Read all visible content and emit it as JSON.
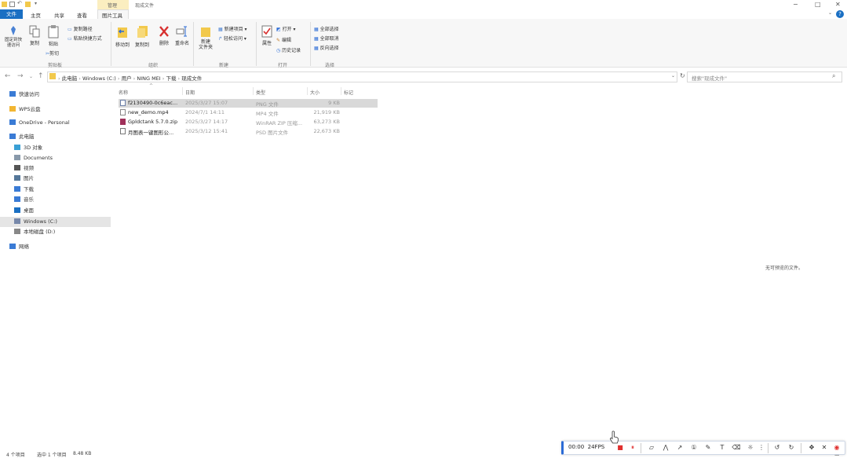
{
  "titlebar": {
    "context_group": "管理",
    "context_title": "现成文件",
    "window_controls": [
      "−",
      "□",
      "✕"
    ]
  },
  "ribbon_tabs": {
    "file": "文件",
    "home": "主页",
    "share": "共享",
    "view": "查看",
    "picture_tools": "图片工具"
  },
  "ribbon": {
    "clipboard": {
      "pin": "固定到快速访问",
      "copy": "复制",
      "paste": "粘贴",
      "copy_path": "复制路径",
      "paste_shortcut": "粘贴快捷方式",
      "cut": "剪切",
      "label": "剪贴板"
    },
    "organize": {
      "move_to": "移动到",
      "copy_to": "复制到",
      "delete": "删除",
      "rename": "重命名",
      "label": "组织"
    },
    "new": {
      "new_folder": "新建\n文件夹",
      "new_item": "新建项目",
      "easy_access": "轻松访问",
      "label": "新建"
    },
    "open": {
      "properties": "属性",
      "open": "打开",
      "edit": "编辑",
      "history": "历史记录",
      "label": "打开"
    },
    "select": {
      "select_all": "全部选择",
      "select_none": "全部取消",
      "invert": "反向选择",
      "label": "选择"
    }
  },
  "address": {
    "crumbs": [
      "此电脑",
      "Windows (C:)",
      "用户",
      "NING MEI",
      "下载",
      "现成文件"
    ],
    "search_placeholder": "搜索\"现成文件\""
  },
  "nav": [
    {
      "label": "快速访问",
      "color": "#3a7bd5"
    },
    {
      "label": "WPS云盘",
      "color": "#f2b632"
    },
    {
      "label": "OneDrive - Personal",
      "color": "#3a7bd5"
    },
    {
      "label": "此电脑",
      "color": "#3a7bd5"
    },
    {
      "label": "3D 对象",
      "color": "#3aa0d5"
    },
    {
      "label": "Documents",
      "color": "#8899aa"
    },
    {
      "label": "视频",
      "color": "#555555"
    },
    {
      "label": "图片",
      "color": "#557799"
    },
    {
      "label": "下载",
      "color": "#3a7bd5"
    },
    {
      "label": "音乐",
      "color": "#3a7bd5"
    },
    {
      "label": "桌面",
      "color": "#1a6fc3"
    },
    {
      "label": "Windows (C:)",
      "color": "#7788aa"
    },
    {
      "label": "本地磁盘 (D:)",
      "color": "#888888"
    },
    {
      "label": "网络",
      "color": "#3a7bd5"
    }
  ],
  "columns": {
    "name": "名称",
    "date": "日期",
    "type": "类型",
    "size": "大小",
    "tags": "标记"
  },
  "files": [
    {
      "name": "f2130490-0c6eac...",
      "date": "2025/3/27 15:07",
      "type": "PNG 文件",
      "size": "9 KB",
      "icon_color": "#6b7fa8"
    },
    {
      "name": "new_demo.mp4",
      "date": "2024/7/1 14:11",
      "type": "MP4 文件",
      "size": "21,919 KB",
      "icon_color": "#888888"
    },
    {
      "name": "Gpldctank 5.7.0.zip",
      "date": "2025/3/27 14:17",
      "type": "WinRAR ZIP 压缩...",
      "size": "63,273 KB",
      "icon_color": "#a0305a"
    },
    {
      "name": "月图表一键图形公...",
      "date": "2025/3/12 15:41",
      "type": "PSD 图片文件",
      "size": "22,673 KB",
      "icon_color": "#777777"
    }
  ],
  "preview_message": "无可预览的文件。",
  "status": {
    "count": "4 个项目",
    "selected": "选中 1 个项目",
    "size": "8.48 KB"
  },
  "recorder": {
    "time": "00:00",
    "fps": "24FPS",
    "accent": "#2b6bd6",
    "stop_color": "#e0302f"
  }
}
